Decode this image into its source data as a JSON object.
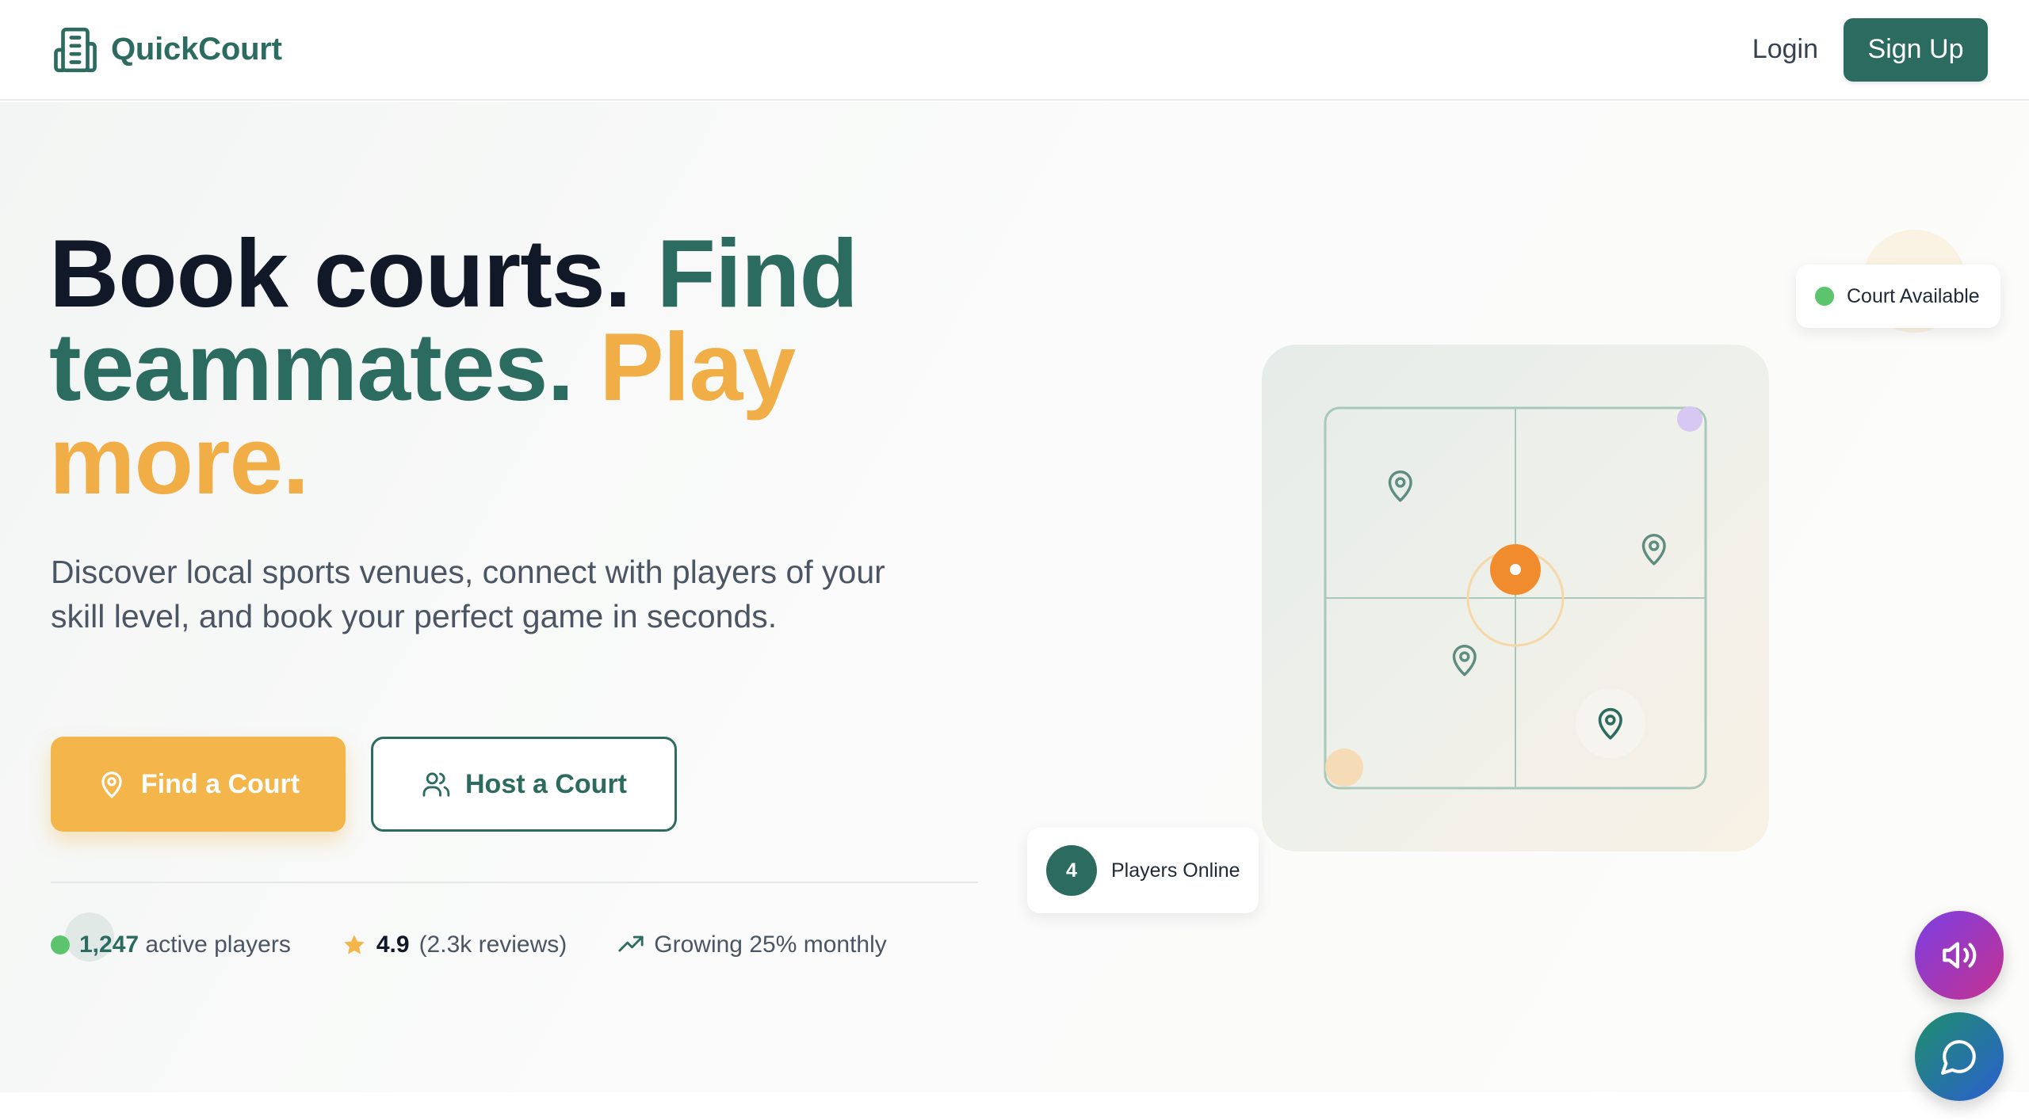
{
  "header": {
    "brand_name": "QuickCourt",
    "login_label": "Login",
    "signup_label": "Sign Up"
  },
  "hero": {
    "headline_part1": "Book courts. ",
    "headline_part2": "Find teammates. ",
    "headline_part3": "Play more.",
    "subtitle": "Discover local sports venues, connect with players of your skill level, and book your perfect game in seconds.",
    "find_label": "Find a Court",
    "host_label": "Host a Court"
  },
  "stats": {
    "players_count": "1,247",
    "players_text": "active players",
    "rating": "4.9",
    "reviews": "(2.3k reviews)",
    "growth": "Growing 25% monthly"
  },
  "map": {
    "court_available": "Court Available",
    "players_online_count": "4",
    "players_online_label": "Players Online"
  },
  "icons": {
    "brand": "building-icon",
    "find": "map-pin-icon",
    "host": "users-icon",
    "rating": "star-icon",
    "growth": "trending-up-icon",
    "audio": "speaker-icon",
    "chat": "chat-bubble-icon"
  },
  "colors": {
    "primary": "#2c6b5f",
    "accent": "#f4b54b",
    "success": "#5cc46d",
    "marker": "#f08c2e"
  }
}
